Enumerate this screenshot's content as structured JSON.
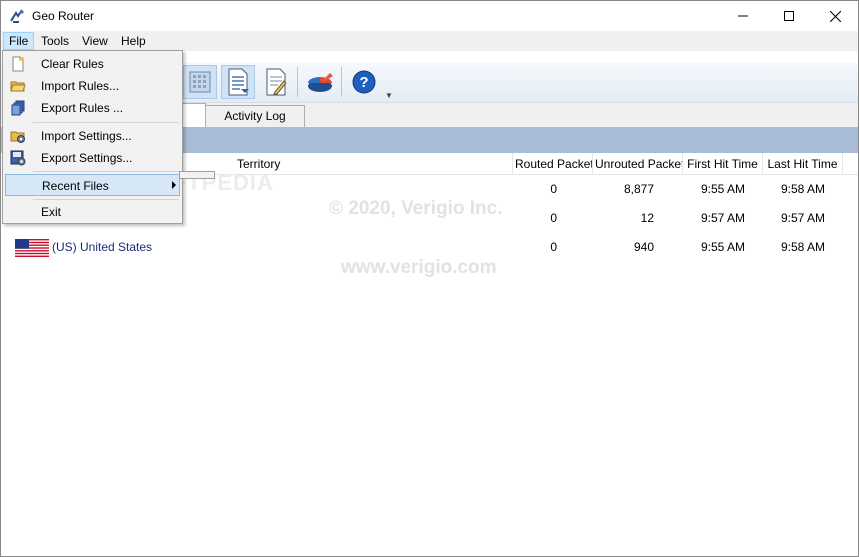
{
  "window": {
    "title": "Geo Router",
    "minimize_icon": "minimize-icon",
    "maximize_icon": "maximize-icon",
    "close_icon": "close-icon"
  },
  "menubar": {
    "items": [
      "File",
      "Tools",
      "View",
      "Help"
    ]
  },
  "file_menu": {
    "items": [
      {
        "label": "Clear Rules",
        "icon": "new-document-icon"
      },
      {
        "label": "Import Rules...",
        "icon": "open-folder-icon"
      },
      {
        "label": "Export Rules ...",
        "icon": "export-rules-icon"
      },
      {
        "label": "Import Settings...",
        "icon": "import-settings-icon"
      },
      {
        "label": "Export Settings...",
        "icon": "export-settings-icon"
      },
      {
        "label": "Recent Files",
        "icon": "",
        "submenu": true
      },
      {
        "label": "Exit",
        "icon": ""
      }
    ]
  },
  "toolbar": {
    "buttons": [
      "grid-view-icon",
      "document-list-icon",
      "document-edit-icon",
      "pie-chart-icon",
      "help-icon"
    ]
  },
  "tabs": {
    "rules": "",
    "activity_log": "Activity Log"
  },
  "table": {
    "columns": [
      "Territory",
      "Routed Packet",
      "Unrouted Packet",
      "First Hit Time",
      "Last Hit Time"
    ],
    "rows": [
      {
        "territory": "",
        "routed": "0",
        "unrouted": "8,877",
        "first_hit": "9:55 AM",
        "last_hit": "9:58 AM"
      },
      {
        "territory": "",
        "routed": "0",
        "unrouted": "12",
        "first_hit": "9:57 AM",
        "last_hit": "9:57 AM"
      },
      {
        "territory": "(US) United States",
        "routed": "0",
        "unrouted": "940",
        "first_hit": "9:55 AM",
        "last_hit": "9:58 AM",
        "flag": "us-flag-icon"
      }
    ]
  },
  "watermarks": {
    "copyright": "© 2020, Verigio Inc.",
    "url": "www.verigio.com",
    "softpedia": "SOFTPEDIA"
  },
  "colors": {
    "group_bar": "#a9bcd6",
    "menu_highlight": "#cce8ff",
    "territory_text": "#1a2d7a"
  }
}
